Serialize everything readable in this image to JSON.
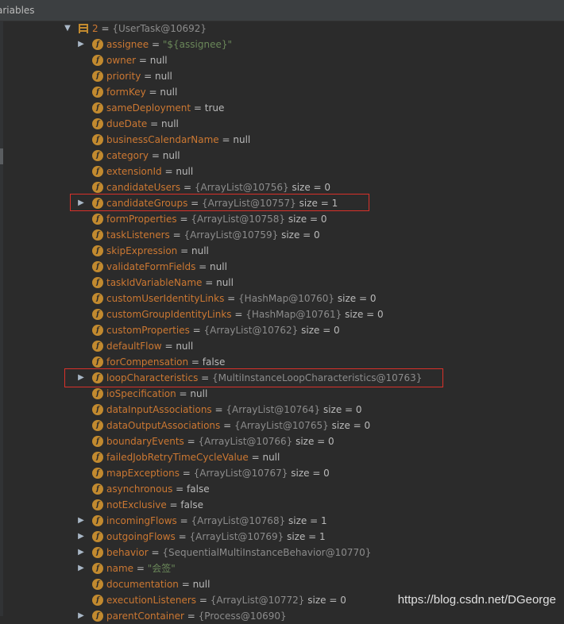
{
  "panel_title": "ariables",
  "root": {
    "index": "2",
    "ref": "{UserTask@10692}"
  },
  "fields": [
    {
      "name": "assignee",
      "str": "\"${assignee}\"",
      "expandable": true
    },
    {
      "name": "owner",
      "value": "null"
    },
    {
      "name": "priority",
      "value": "null"
    },
    {
      "name": "formKey",
      "value": "null"
    },
    {
      "name": "sameDeployment",
      "value": "true"
    },
    {
      "name": "dueDate",
      "value": "null"
    },
    {
      "name": "businessCalendarName",
      "value": "null"
    },
    {
      "name": "category",
      "value": "null"
    },
    {
      "name": "extensionId",
      "value": "null"
    },
    {
      "name": "candidateUsers",
      "ref": "{ArrayList@10756}",
      "size": "size = 0"
    },
    {
      "name": "candidateGroups",
      "ref": "{ArrayList@10757}",
      "size": "size = 1",
      "expandable": true,
      "highlight": true
    },
    {
      "name": "formProperties",
      "ref": "{ArrayList@10758}",
      "size": "size = 0"
    },
    {
      "name": "taskListeners",
      "ref": "{ArrayList@10759}",
      "size": "size = 0"
    },
    {
      "name": "skipExpression",
      "value": "null"
    },
    {
      "name": "validateFormFields",
      "value": "null"
    },
    {
      "name": "taskIdVariableName",
      "value": "null"
    },
    {
      "name": "customUserIdentityLinks",
      "ref": "{HashMap@10760}",
      "size": "size = 0"
    },
    {
      "name": "customGroupIdentityLinks",
      "ref": "{HashMap@10761}",
      "size": "size = 0"
    },
    {
      "name": "customProperties",
      "ref": "{ArrayList@10762}",
      "size": "size = 0"
    },
    {
      "name": "defaultFlow",
      "value": "null"
    },
    {
      "name": "forCompensation",
      "value": "false"
    },
    {
      "name": "loopCharacteristics",
      "ref": "{MultiInstanceLoopCharacteristics@10763}",
      "expandable": true,
      "highlight": true
    },
    {
      "name": "ioSpecification",
      "value": "null"
    },
    {
      "name": "dataInputAssociations",
      "ref": "{ArrayList@10764}",
      "size": "size = 0"
    },
    {
      "name": "dataOutputAssociations",
      "ref": "{ArrayList@10765}",
      "size": "size = 0"
    },
    {
      "name": "boundaryEvents",
      "ref": "{ArrayList@10766}",
      "size": "size = 0"
    },
    {
      "name": "failedJobRetryTimeCycleValue",
      "value": "null"
    },
    {
      "name": "mapExceptions",
      "ref": "{ArrayList@10767}",
      "size": "size = 0"
    },
    {
      "name": "asynchronous",
      "value": "false"
    },
    {
      "name": "notExclusive",
      "value": "false"
    },
    {
      "name": "incomingFlows",
      "ref": "{ArrayList@10768}",
      "size": "size = 1",
      "expandable": true
    },
    {
      "name": "outgoingFlows",
      "ref": "{ArrayList@10769}",
      "size": "size = 1",
      "expandable": true
    },
    {
      "name": "behavior",
      "ref": "{SequentialMultiInstanceBehavior@10770}",
      "expandable": true
    },
    {
      "name": "name",
      "str": "\"会签\"",
      "expandable": true
    },
    {
      "name": "documentation",
      "value": "null"
    },
    {
      "name": "executionListeners",
      "ref": "{ArrayList@10772}",
      "size": "size = 0"
    },
    {
      "name": "parentContainer",
      "ref": "{Process@10690}",
      "expandable": true
    }
  ],
  "watermark": "https://blog.csdn.net/DGeorge"
}
